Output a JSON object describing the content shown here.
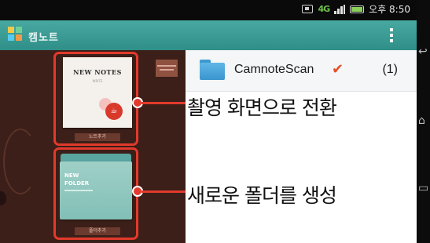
{
  "status_bar": {
    "time": "오후 8:50",
    "icons": [
      "screenshot-icon",
      "network-icon",
      "signal-icon",
      "battery-icon"
    ],
    "network_label": "4G"
  },
  "app_bar": {
    "title": "캠노트",
    "menu_icon": "overflow-menu-icon",
    "color": "#3a9e97"
  },
  "left_panel": {
    "notebook": {
      "title": "NEW NOTES",
      "subtitle": "WRITE",
      "label": "노트추가"
    },
    "folder": {
      "line1": "NEW",
      "line2": "FOLDER",
      "label": "폴더추가"
    }
  },
  "folder_list": [
    {
      "name": "CamnoteScan",
      "checked": true,
      "count": "(1)"
    }
  ],
  "annotations": {
    "capture_label": "촬영 화면으로 전환",
    "new_folder_label": "새로운 폴더를 생성",
    "accent": "#e23a2c"
  },
  "nav": {
    "back_icon": "back-icon",
    "home_icon": "home-icon",
    "recent_icon": "recent-apps-icon"
  }
}
